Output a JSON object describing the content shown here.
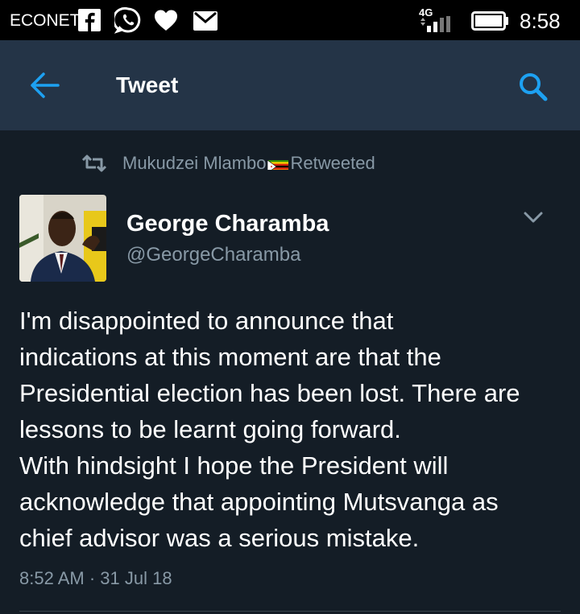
{
  "status_bar": {
    "carrier": "ECONET",
    "network": "4G",
    "time": "8:58",
    "icons": [
      "facebook-icon",
      "whatsapp-icon",
      "heart-icon",
      "mail-icon",
      "signal-icon",
      "battery-icon"
    ]
  },
  "app_bar": {
    "title": "Tweet",
    "back_icon": "arrow-left-icon",
    "search_icon": "search-icon",
    "accent_color": "#1da1f2"
  },
  "retweet": {
    "icon": "retweet-icon",
    "user": "Mukudzei Mlambo",
    "label": "Retweeted"
  },
  "tweet": {
    "author_name": "George Charamba",
    "author_handle": "@GeorgeCharamba",
    "text": "I'm disappointed to announce that\nindications at this moment are that the\nPresidential election has been lost. There are\nlessons to be learnt going forward.\nWith hindsight I hope the President will\nacknowledge that appointing Mutsvanga as\nchief advisor was a serious mistake.",
    "timestamp": "8:52 AM · 31 Jul 18"
  },
  "colors": {
    "background": "#141d26",
    "app_bar": "#243447",
    "secondary_text": "#8899a6"
  }
}
